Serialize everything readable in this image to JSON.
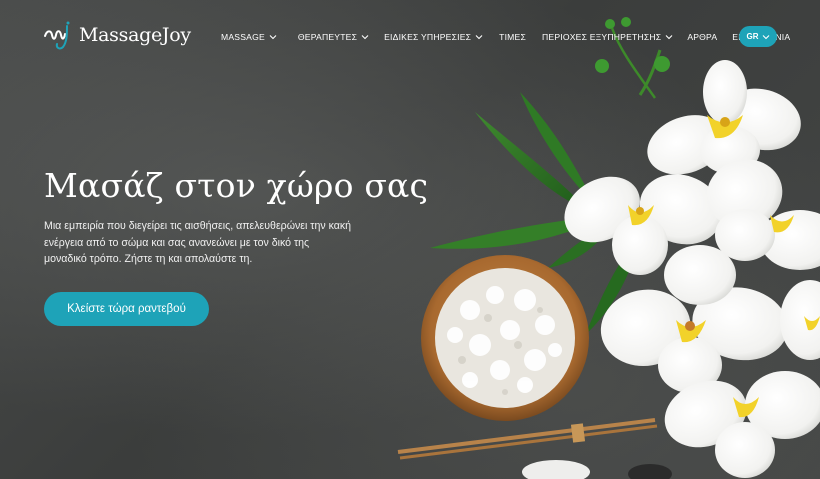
{
  "brand": {
    "name_part1": "Massage",
    "name_part2": "Joy",
    "accent_color": "#1ea3b8"
  },
  "nav": {
    "items": [
      {
        "label": "MASSAGE",
        "has_dropdown": true
      },
      {
        "label": "ΘΕΡΑΠΕΥΤΕΣ",
        "has_dropdown": true
      },
      {
        "label": "ΕΙΔΙΚΕΣ ΥΠΗΡΕΣΙΕΣ",
        "has_dropdown": true
      },
      {
        "label": "ΤΙΜΕΣ",
        "has_dropdown": false
      },
      {
        "label": "ΠΕΡΙΟΧΕΣ ΕΞΥΠΗΡΕΤΗΣΗΣ",
        "has_dropdown": true
      },
      {
        "label": "ΑΡΘΡΑ",
        "has_dropdown": false
      },
      {
        "label": "ΕΠΙΚΟΙΝΩΝΙΑ",
        "has_dropdown": false
      }
    ],
    "language": "GR"
  },
  "hero": {
    "headline": "Μασάζ στον χώρο σας",
    "subtext": "Μια εμπειρία που διεγείρει τις αισθήσεις, απελευθερώνει την κακή ενέργεια από το σώμα και σας ανανεώνει με τον δικό της μοναδικό τρόπο. Ζήστε τη και απολαύστε τη.",
    "cta_label": "Κλείστε τώρα ραντεβού"
  },
  "icons": [
    "logo-mark-icon",
    "chevron-down-icon",
    "orchid-flower-image",
    "salt-bowl-image",
    "bamboo-leaf-image"
  ]
}
